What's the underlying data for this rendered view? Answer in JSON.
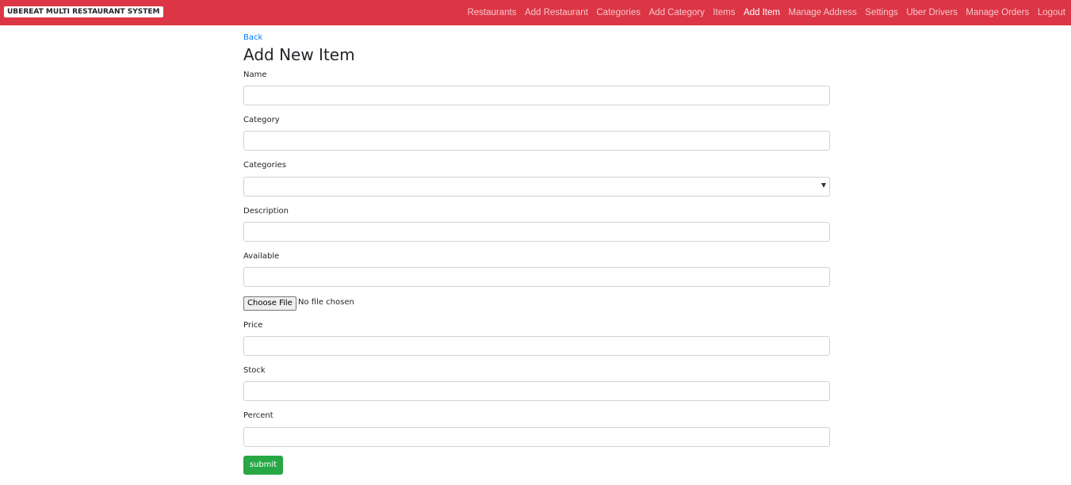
{
  "navbar": {
    "brand": "UBEREAT MULTI RESTAURANT SYSTEM",
    "links": [
      {
        "label": "Restaurants",
        "active": false
      },
      {
        "label": "Add Restaurant",
        "active": false
      },
      {
        "label": "Categories",
        "active": false
      },
      {
        "label": "Add Category",
        "active": false
      },
      {
        "label": "Items",
        "active": false
      },
      {
        "label": "Add Item",
        "active": true
      },
      {
        "label": "Manage Address",
        "active": false
      },
      {
        "label": "Settings",
        "active": false
      },
      {
        "label": "Uber Drivers",
        "active": false
      },
      {
        "label": "Manage Orders",
        "active": false
      },
      {
        "label": "Logout",
        "active": false
      }
    ],
    "background_color": "#dc3545"
  },
  "page": {
    "back_label": "Back",
    "title": "Add New Item"
  },
  "form": {
    "name": {
      "label": "Name",
      "value": "",
      "placeholder": ""
    },
    "category": {
      "label": "Category",
      "value": "",
      "placeholder": ""
    },
    "categories": {
      "label": "Categories",
      "selected": ""
    },
    "description": {
      "label": "Description",
      "value": "",
      "placeholder": ""
    },
    "available": {
      "label": "Available",
      "value": "",
      "placeholder": ""
    },
    "file": {
      "button_label": "Choose File",
      "status": "No file chosen"
    },
    "price": {
      "label": "Price",
      "value": "",
      "placeholder": ""
    },
    "stock": {
      "label": "Stock",
      "value": "",
      "placeholder": ""
    },
    "percent": {
      "label": "Percent",
      "value": "",
      "placeholder": ""
    },
    "submit_label": "submit",
    "submit_color": "#28a745"
  }
}
